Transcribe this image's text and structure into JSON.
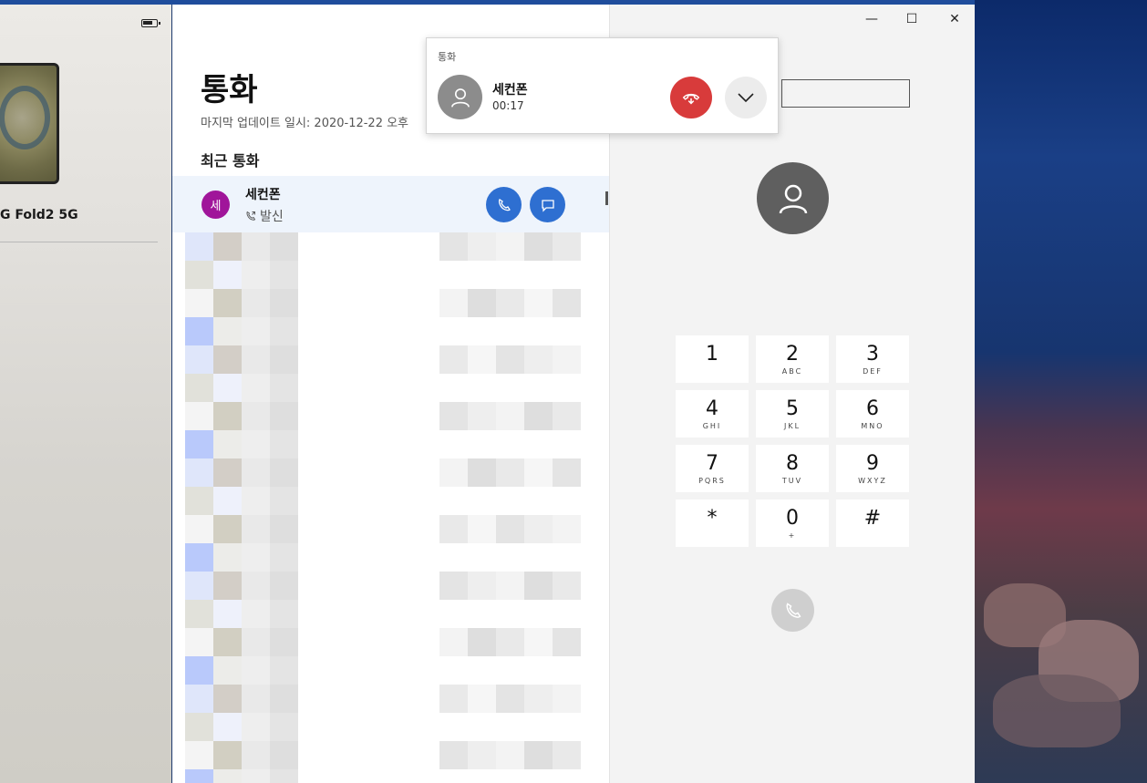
{
  "device": {
    "name": "G Fold2 5G"
  },
  "calls": {
    "title": "통화",
    "last_updated": "마지막 업데이트 일시: 2020-12-22 오후",
    "recent_header": "최근 통화",
    "recent": [
      {
        "avatar_initial": "세",
        "name": "세컨폰",
        "type": "발신",
        "avatar_color": "#a0159a"
      }
    ]
  },
  "popup": {
    "title": "통화",
    "caller_name": "세컨폰",
    "timer": "00:17",
    "hangup_color": "#d83b3b"
  },
  "dialer": {
    "window_controls": {
      "minimize": "—",
      "maximize": "☐",
      "close": "✕"
    },
    "keys": [
      {
        "digit": "1",
        "letters": ""
      },
      {
        "digit": "2",
        "letters": "ABC"
      },
      {
        "digit": "3",
        "letters": "DEF"
      },
      {
        "digit": "4",
        "letters": "GHI"
      },
      {
        "digit": "5",
        "letters": "JKL"
      },
      {
        "digit": "6",
        "letters": "MNO"
      },
      {
        "digit": "7",
        "letters": "PQRS"
      },
      {
        "digit": "8",
        "letters": "TUV"
      },
      {
        "digit": "9",
        "letters": "WXYZ"
      },
      {
        "digit": "*",
        "letters": ""
      },
      {
        "digit": "0",
        "letters": "+"
      },
      {
        "digit": "#",
        "letters": ""
      }
    ]
  },
  "colors": {
    "accent": "#2e6fd1",
    "avatar_gray": "#5f5f5f"
  }
}
